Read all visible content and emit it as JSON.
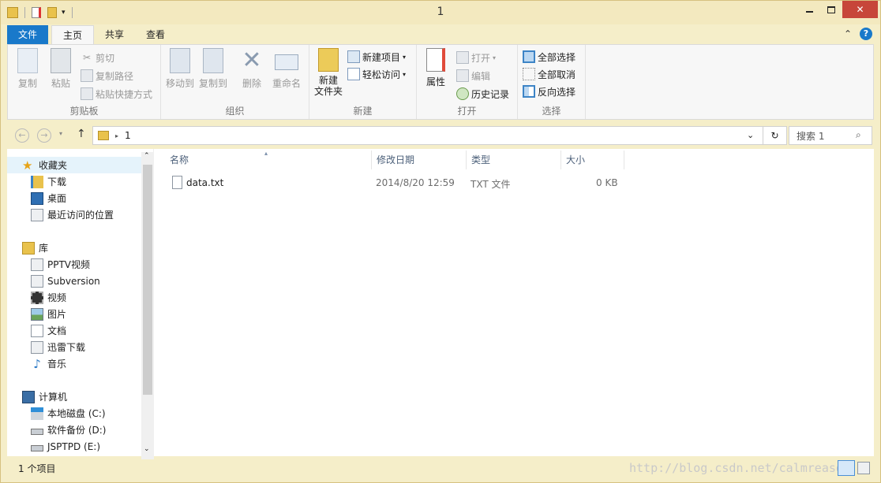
{
  "window": {
    "title": "1",
    "min": "—",
    "max": "□",
    "close": "✕"
  },
  "tabs": {
    "file": "文件",
    "home": "主页",
    "share": "共享",
    "view": "查看",
    "help": "?"
  },
  "ribbon": {
    "clipboard": {
      "label": "剪贴板",
      "copy": "复制",
      "paste": "粘贴",
      "cut": "剪切",
      "copy_path": "复制路径",
      "paste_shortcut": "粘贴快捷方式"
    },
    "organize": {
      "label": "组织",
      "move_to": "移动到",
      "copy_to": "复制到",
      "delete": "删除",
      "rename": "重命名"
    },
    "new": {
      "label": "新建",
      "new_item": "新建项目",
      "easy_access": "轻松访问",
      "new_folder": "新建\n文件夹"
    },
    "open": {
      "label": "打开",
      "properties": "属性",
      "open": "打开",
      "edit": "编辑",
      "history": "历史记录"
    },
    "select": {
      "label": "选择",
      "select_all": "全部选择",
      "select_none": "全部取消",
      "invert": "反向选择"
    }
  },
  "address": {
    "crumb": "1",
    "search_placeholder": "搜索 1"
  },
  "nav": {
    "favorites": "收藏夹",
    "downloads": "下载",
    "desktop": "桌面",
    "recent": "最近访问的位置",
    "libraries": "库",
    "pptv": "PPTV视频",
    "subversion": "Subversion",
    "videos": "视频",
    "pictures": "图片",
    "documents": "文档",
    "xunlei": "迅雷下载",
    "music": "音乐",
    "computer": "计算机",
    "c": "本地磁盘 (C:)",
    "d": "软件备份 (D:)",
    "e": "JSPTPD (E:)"
  },
  "columns": {
    "name": "名称",
    "date": "修改日期",
    "type": "类型",
    "size": "大小"
  },
  "files": [
    {
      "name": "data.txt",
      "date": "2014/8/20 12:59",
      "type": "TXT 文件",
      "size": "0 KB"
    }
  ],
  "status": {
    "count": "1 个项目",
    "watermark": "http://blog.csdn.net/calmreason"
  },
  "colors": {
    "file_tab": "#1979ca",
    "frame": "#f3e9bf",
    "accent": "#1979ca"
  }
}
